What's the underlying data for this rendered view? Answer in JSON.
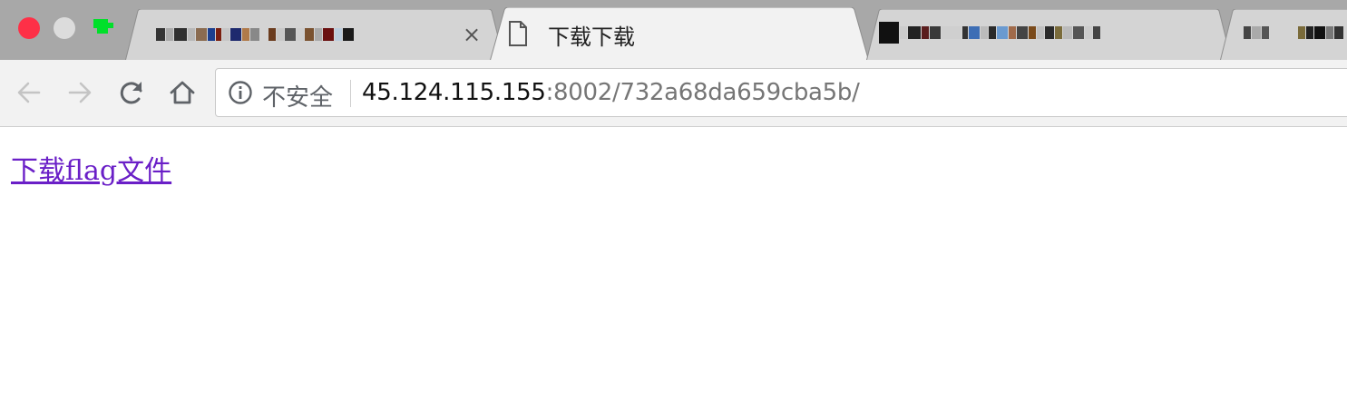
{
  "window": {
    "controls": [
      "close-button",
      "minimize-button",
      "zoom-button"
    ]
  },
  "tabs": [
    {
      "title": "",
      "obscured": true,
      "closable": true,
      "close_glyph": "×"
    },
    {
      "title": "下载下载",
      "active": true,
      "icon": "document-icon"
    },
    {
      "title": "",
      "obscured": true
    },
    {
      "title": "",
      "obscured": true
    }
  ],
  "toolbar": {
    "back": "arrow-left-icon",
    "forward": "arrow-right-icon",
    "reload": "reload-icon",
    "home": "home-icon"
  },
  "omnibox": {
    "security_label": "不安全",
    "url_host": "45.124.115.155",
    "url_rest": ":8002/732a68da659cba5b/"
  },
  "page": {
    "link_text": "下载flag文件"
  },
  "colors": {
    "link_visited": "#6a1fc7",
    "close_red": "#fe3047",
    "zoom_green": "#00e02a",
    "tabstrip": "#a8a8a8",
    "toolbar": "#f2f2f2"
  }
}
